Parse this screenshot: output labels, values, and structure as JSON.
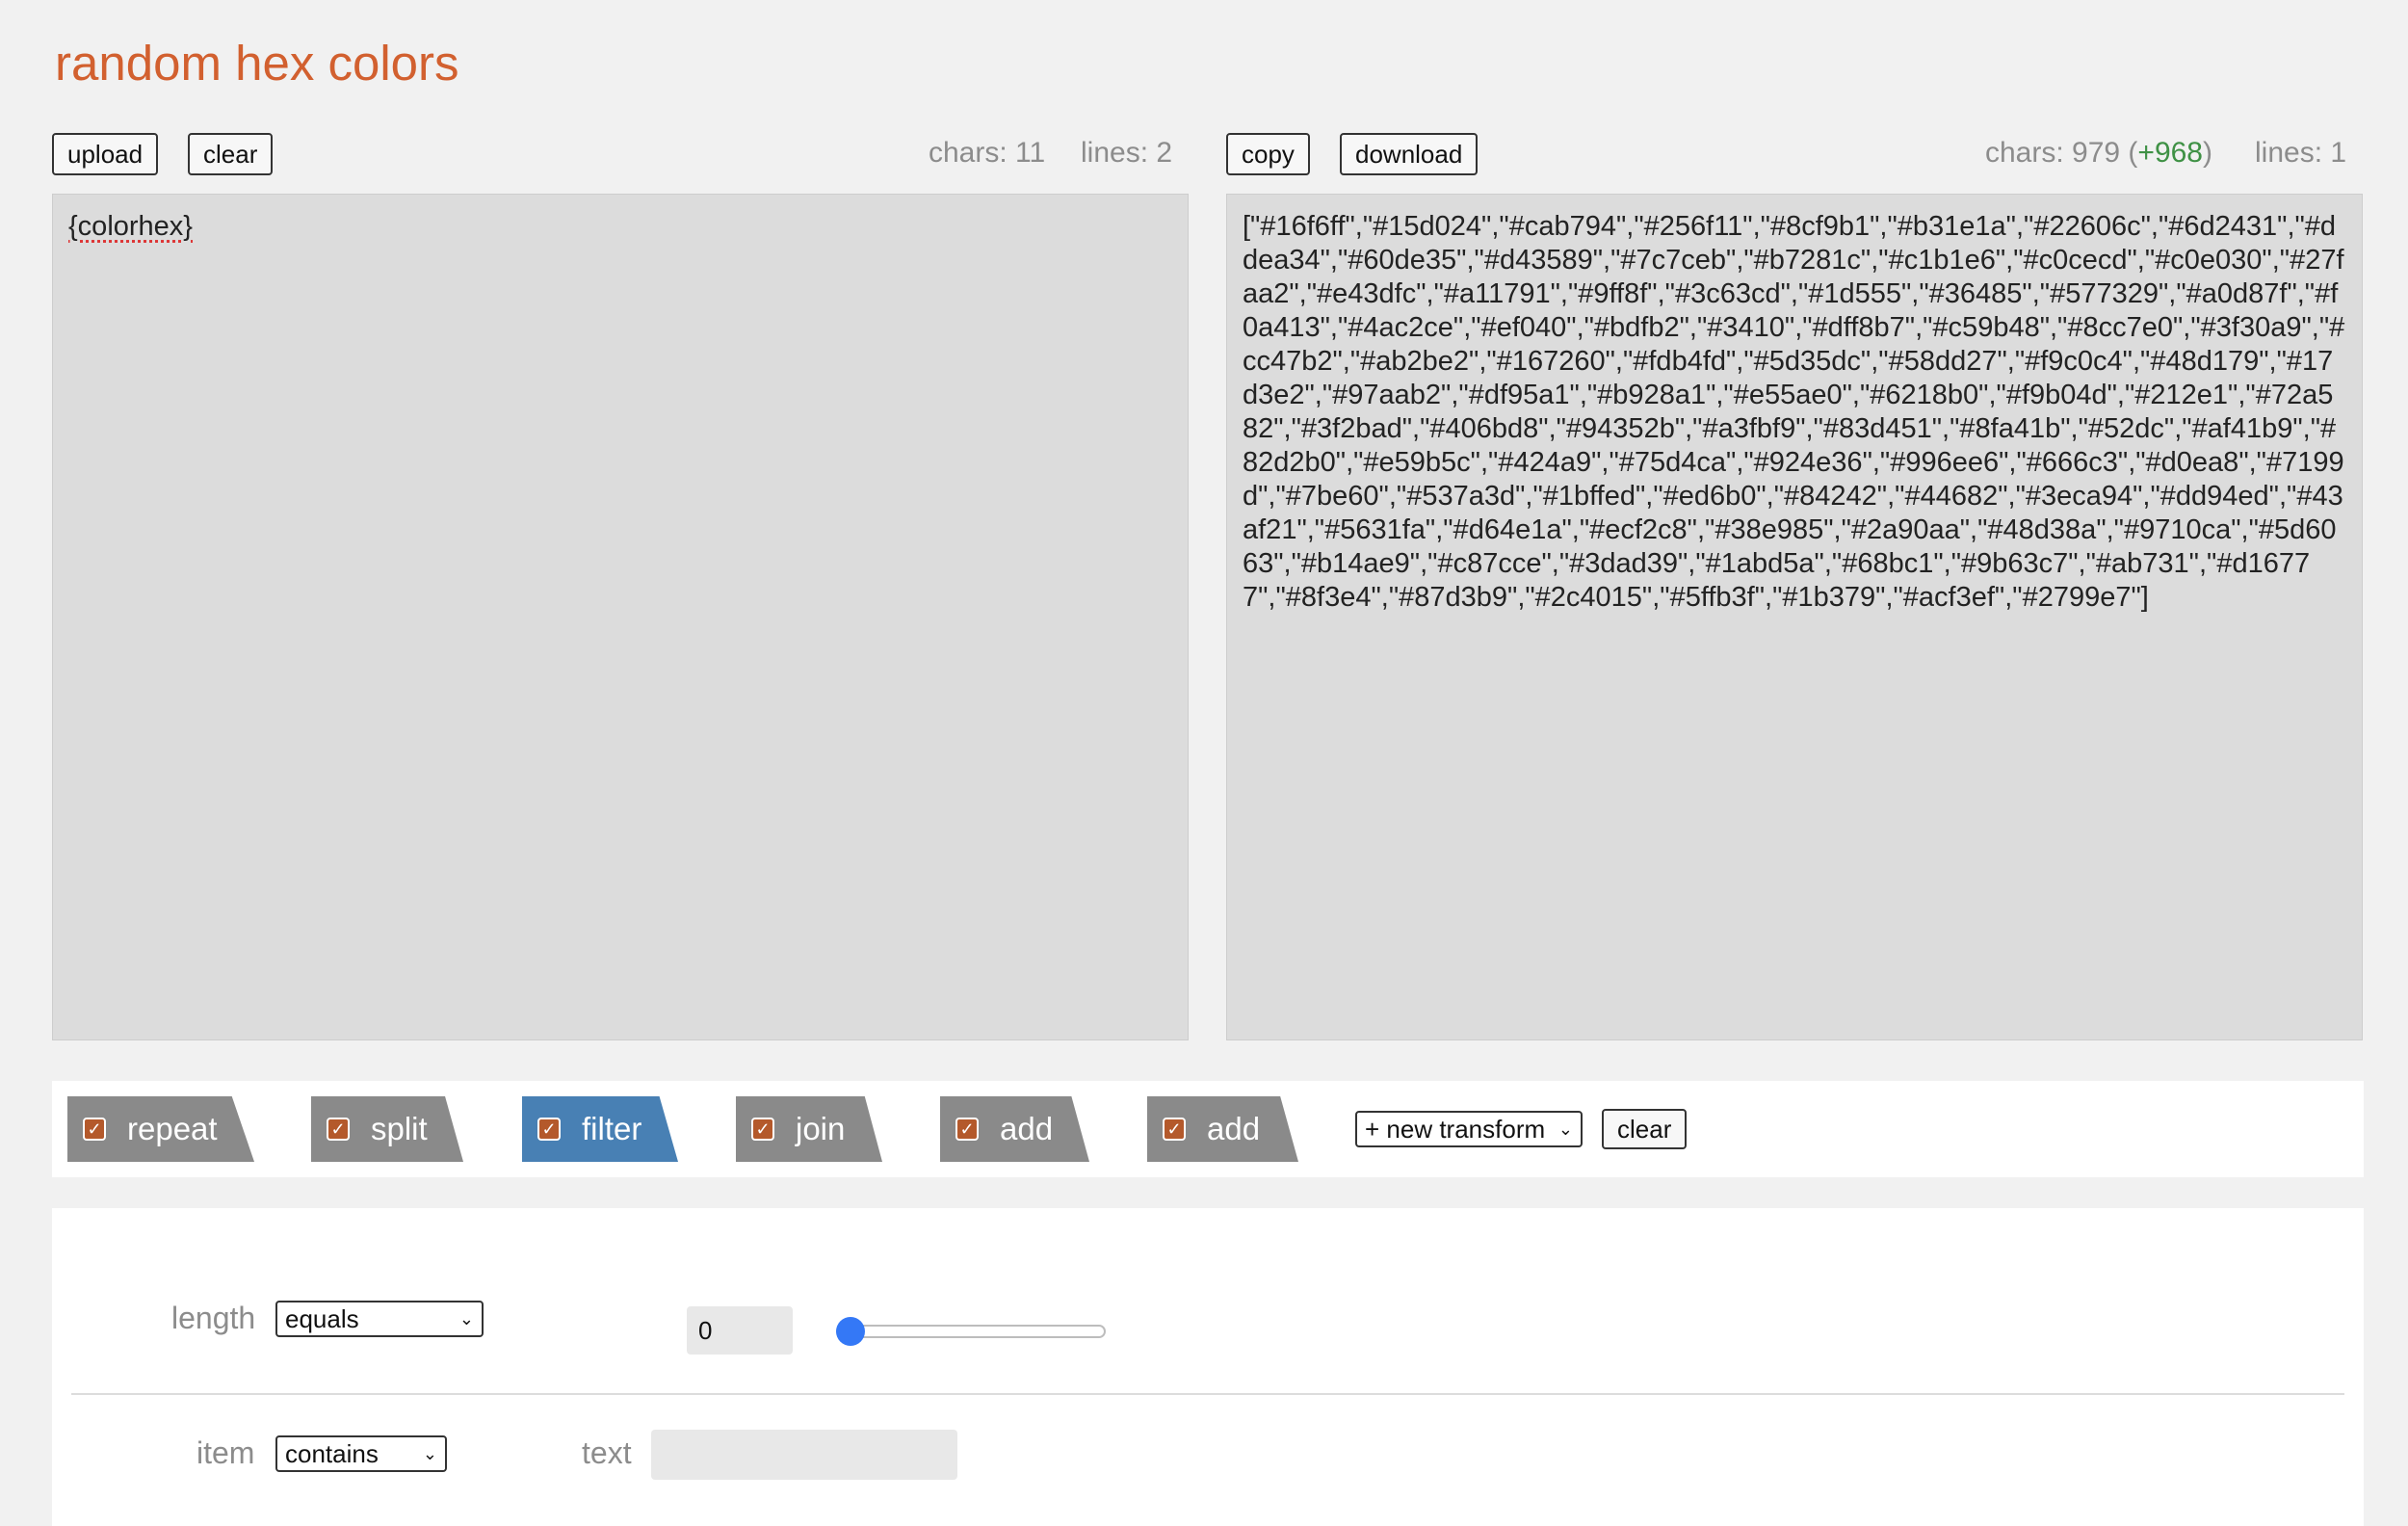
{
  "title": "random hex colors",
  "input": {
    "upload_label": "upload",
    "clear_label": "clear",
    "chars": "chars: 11",
    "lines": "lines: 2",
    "text": "{colorhex}"
  },
  "output": {
    "copy_label": "copy",
    "download_label": "download",
    "chars": "chars: 979 (",
    "chars_delta": "+968",
    "chars_close": ")",
    "lines": "lines: 1",
    "text": "[\"#16f6ff\",\"#15d024\",\"#cab794\",\"#256f11\",\"#8cf9b1\",\"#b31e1a\",\"#22606c\",\"#6d2431\",\"#ddea34\",\"#60de35\",\"#d43589\",\"#7c7ceb\",\"#b7281c\",\"#c1b1e6\",\"#c0cecd\",\"#c0e030\",\"#27faa2\",\"#e43dfc\",\"#a11791\",\"#9ff8f\",\"#3c63cd\",\"#1d555\",\"#36485\",\"#577329\",\"#a0d87f\",\"#f0a413\",\"#4ac2ce\",\"#ef040\",\"#bdfb2\",\"#3410\",\"#dff8b7\",\"#c59b48\",\"#8cc7e0\",\"#3f30a9\",\"#cc47b2\",\"#ab2be2\",\"#167260\",\"#fdb4fd\",\"#5d35dc\",\"#58dd27\",\"#f9c0c4\",\"#48d179\",\"#17d3e2\",\"#97aab2\",\"#df95a1\",\"#b928a1\",\"#e55ae0\",\"#6218b0\",\"#f9b04d\",\"#212e1\",\"#72a582\",\"#3f2bad\",\"#406bd8\",\"#94352b\",\"#a3fbf9\",\"#83d451\",\"#8fa41b\",\"#52dc\",\"#af41b9\",\"#82d2b0\",\"#e59b5c\",\"#424a9\",\"#75d4ca\",\"#924e36\",\"#996ee6\",\"#666c3\",\"#d0ea8\",\"#7199d\",\"#7be60\",\"#537a3d\",\"#1bffed\",\"#ed6b0\",\"#84242\",\"#44682\",\"#3eca94\",\"#dd94ed\",\"#43af21\",\"#5631fa\",\"#d64e1a\",\"#ecf2c8\",\"#38e985\",\"#2a90aa\",\"#48d38a\",\"#9710ca\",\"#5d6063\",\"#b14ae9\",\"#c87cce\",\"#3dad39\",\"#1abd5a\",\"#68bc1\",\"#9b63c7\",\"#ab731\",\"#d16777\",\"#8f3e4\",\"#87d3b9\",\"#2c4015\",\"#5ffb3f\",\"#1b379\",\"#acf3ef\",\"#2799e7\"]"
  },
  "transforms": {
    "tabs": [
      {
        "label": "repeat",
        "checked": true,
        "active": false
      },
      {
        "label": "split",
        "checked": true,
        "active": false
      },
      {
        "label": "filter",
        "checked": true,
        "active": true
      },
      {
        "label": "join",
        "checked": true,
        "active": false
      },
      {
        "label": "add",
        "checked": true,
        "active": false
      },
      {
        "label": "add",
        "checked": true,
        "active": false
      }
    ],
    "new_transform_label": "+ new transform",
    "clear_label": "clear"
  },
  "filter": {
    "length_label": "length",
    "length_mode": "equals",
    "length_value": "0",
    "slider_level": 0,
    "item_label": "item",
    "item_mode": "contains",
    "text_label": "text",
    "text_value": ""
  },
  "colors": {
    "title": "#d2602f",
    "active_tab": "#4880b4",
    "tab": "#8a8a8a",
    "checkbox": "#b4592b",
    "delta": "#3f9145",
    "slider": "#3478f6"
  }
}
